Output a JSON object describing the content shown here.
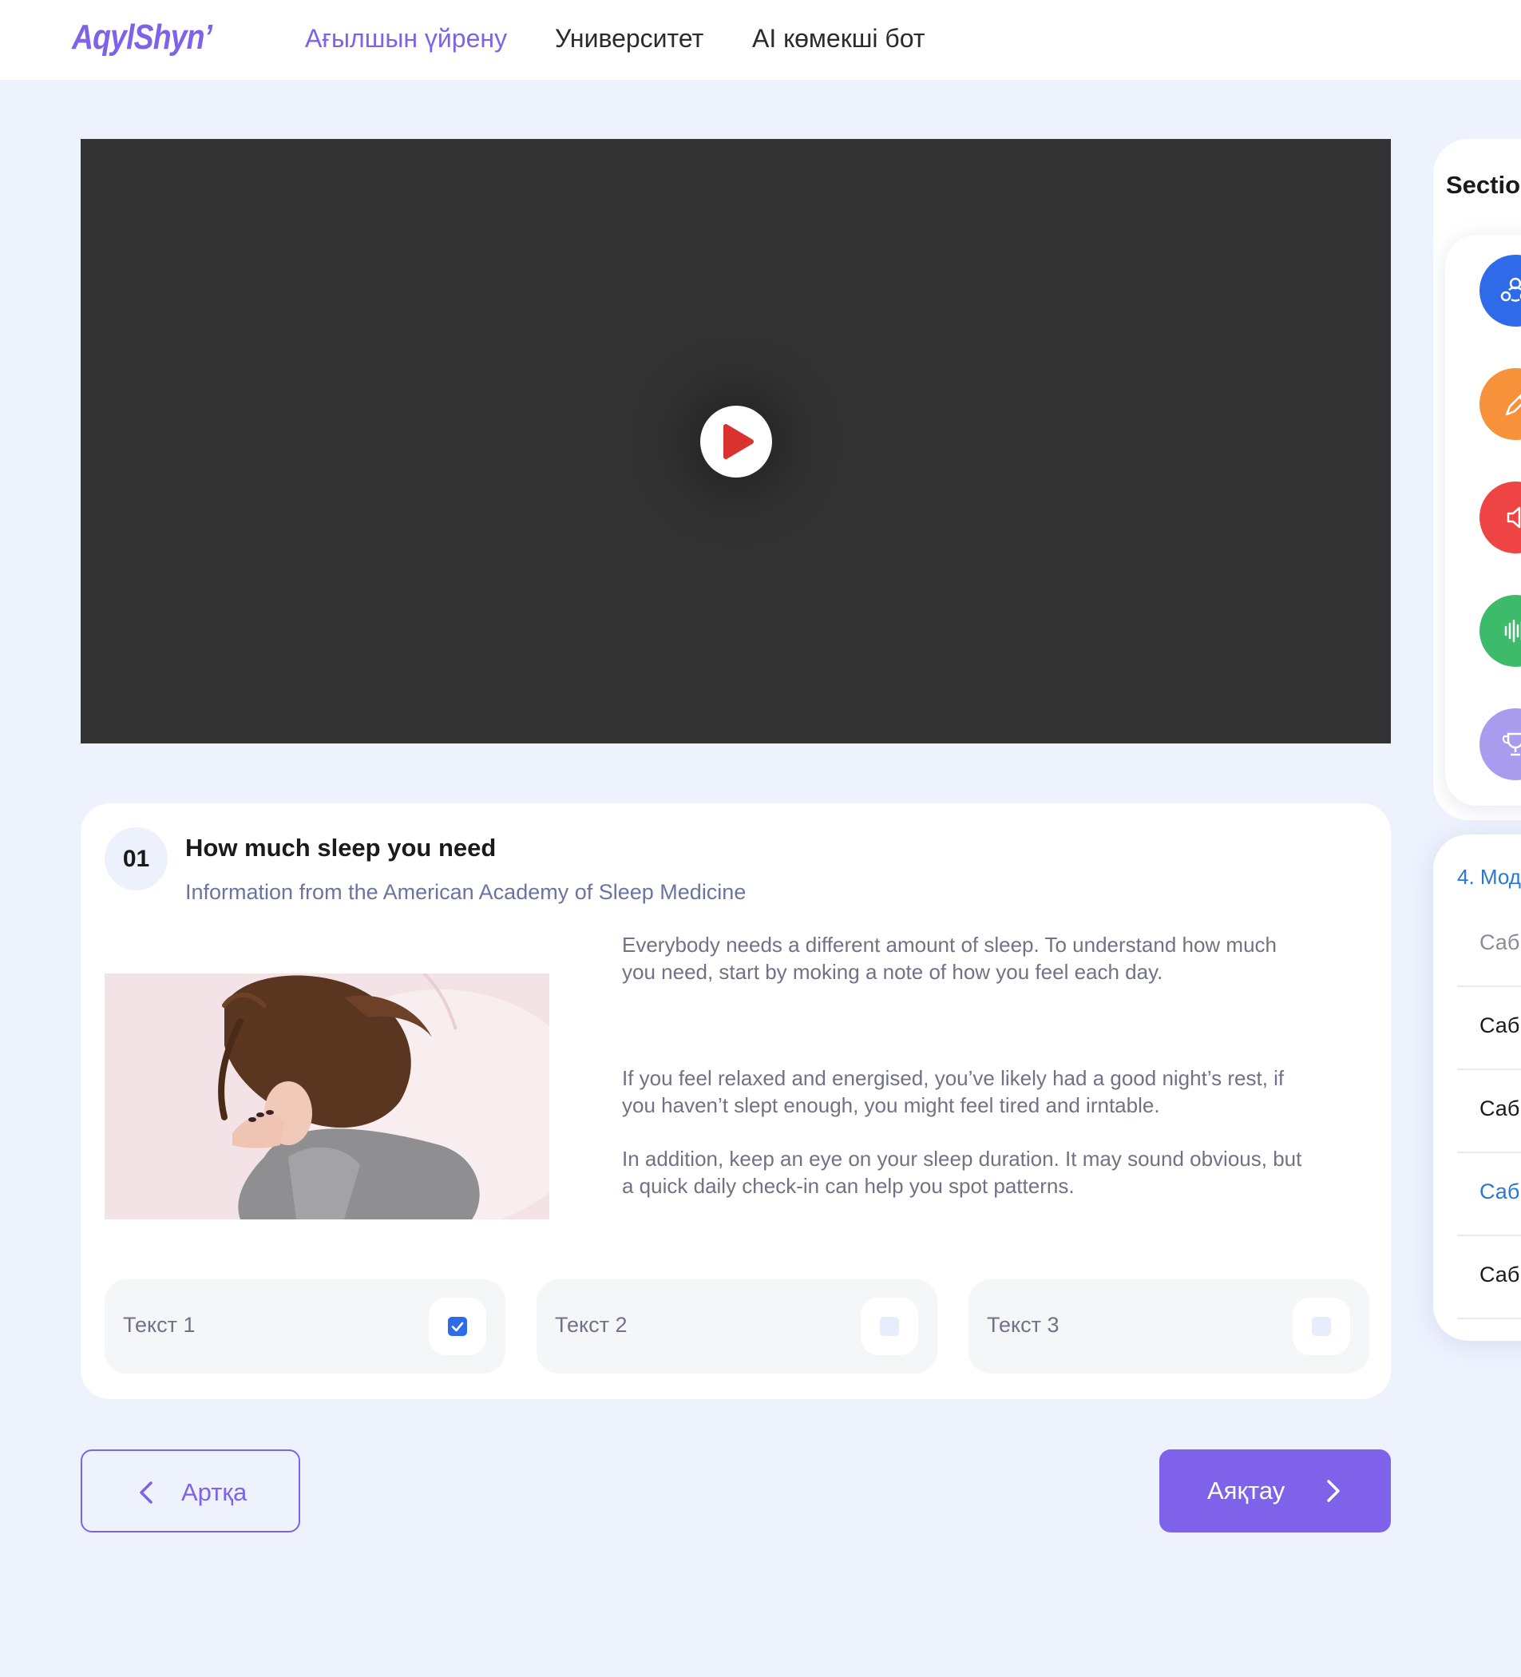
{
  "header": {
    "logo": "AqylShyn’",
    "nav": [
      {
        "label": "Ағылшын үйрену",
        "active": true
      },
      {
        "label": "Университет",
        "active": false
      },
      {
        "label": "AI көмекші бот",
        "active": false
      }
    ]
  },
  "video": {
    "play_icon": "play-icon"
  },
  "sidebar": {
    "sections_title": "Sectio",
    "section_icons": [
      {
        "icon": "group-icon",
        "color": "#2f6be8"
      },
      {
        "icon": "pen-icon",
        "color": "#f7923a"
      },
      {
        "icon": "speaker-icon",
        "color": "#ef4444"
      },
      {
        "icon": "audio-wave-icon",
        "color": "#3dbb6a"
      },
      {
        "icon": "trophy-icon",
        "color": "#a99cef"
      }
    ],
    "module_title": "4. Мод",
    "lessons": [
      {
        "label": "Саб",
        "color": "#8a8d99"
      },
      {
        "label": "Саб",
        "color": "#1a1a1a"
      },
      {
        "label": "Саб",
        "color": "#1a1a1a"
      },
      {
        "label": "Саб",
        "color": "#2a78d4"
      },
      {
        "label": "Саб",
        "color": "#1a1a1a"
      }
    ]
  },
  "card": {
    "number": "01",
    "title": "How much sleep you need",
    "subtitle": "Information from the American Academy of Sleep Medicine",
    "paragraphs": [
      "Everybody needs a different amount of sleep. To understand how much you need, start by moking a note of how you feel each day.",
      "If you feel relaxed and energised, you’ve likely had a good night’s rest, if you haven’t slept enough, you might feel tired and irntable.",
      "In addition, keep an eye on your sleep duration. It may sound obvious, but a quick daily check-in can help you spot patterns."
    ],
    "options": [
      {
        "label": "Текст 1",
        "checked": true
      },
      {
        "label": "Текст 2",
        "checked": false
      },
      {
        "label": "Текст 3",
        "checked": false
      }
    ]
  },
  "footer": {
    "back_label": "Артқа",
    "finish_label": "Аяқтау"
  }
}
